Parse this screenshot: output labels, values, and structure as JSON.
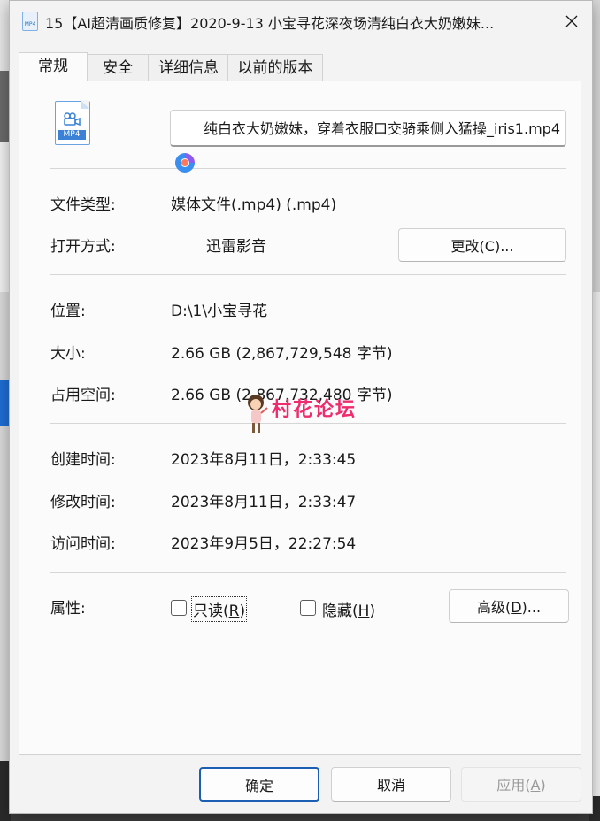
{
  "window": {
    "title": "15【AI超清画质修复】2020-9-13 小宝寻花深夜场清纯白衣大奶嫩妹...",
    "title_icon": "mp4-file-icon",
    "close_icon": "close-icon"
  },
  "tabs": [
    {
      "label": "常规",
      "active": true
    },
    {
      "label": "安全",
      "active": false
    },
    {
      "label": "详细信息",
      "active": false
    },
    {
      "label": "以前的版本",
      "active": false
    }
  ],
  "file": {
    "icon_label": "MP4",
    "name": "纯白衣大奶嫩妹，穿着衣服口交骑乘侧入猛操_iris1.mp4"
  },
  "info": {
    "type_label": "文件类型:",
    "type_value": "媒体文件(.mp4) (.mp4)",
    "open_with_label": "打开方式:",
    "open_with_app": "迅雷影音",
    "change_button": "更改(C)...",
    "location_label": "位置:",
    "location_value": "D:\\1\\小宝寻花",
    "size_label": "大小:",
    "size_value": "2.66 GB (2,867,729,548 字节)",
    "disk_size_label": "占用空间:",
    "disk_size_value": "2.66 GB (2,867,732,480 字节)",
    "created_label": "创建时间:",
    "created_value": "2023年8月11日，2:33:45",
    "modified_label": "修改时间:",
    "modified_value": "2023年8月11日，2:33:47",
    "accessed_label": "访问时间:",
    "accessed_value": "2023年9月5日，22:27:54",
    "attributes_label": "属性:",
    "readonly_label_pre": "只读(",
    "readonly_key": "R",
    "readonly_label_post": ")",
    "hidden_label_pre": "隐藏(",
    "hidden_key": "H",
    "hidden_label_post": ")",
    "advanced_button_pre": "高级(",
    "advanced_key": "D",
    "advanced_button_post": ")..."
  },
  "watermark": {
    "text": "村花论坛"
  },
  "footer": {
    "ok": "确定",
    "cancel": "取消",
    "apply_pre": "应用(",
    "apply_key": "A",
    "apply_post": ")"
  },
  "colors": {
    "accent": "#1a5fb4",
    "watermark": "#ee2c6e",
    "icon_blue": "#3b82d6"
  }
}
